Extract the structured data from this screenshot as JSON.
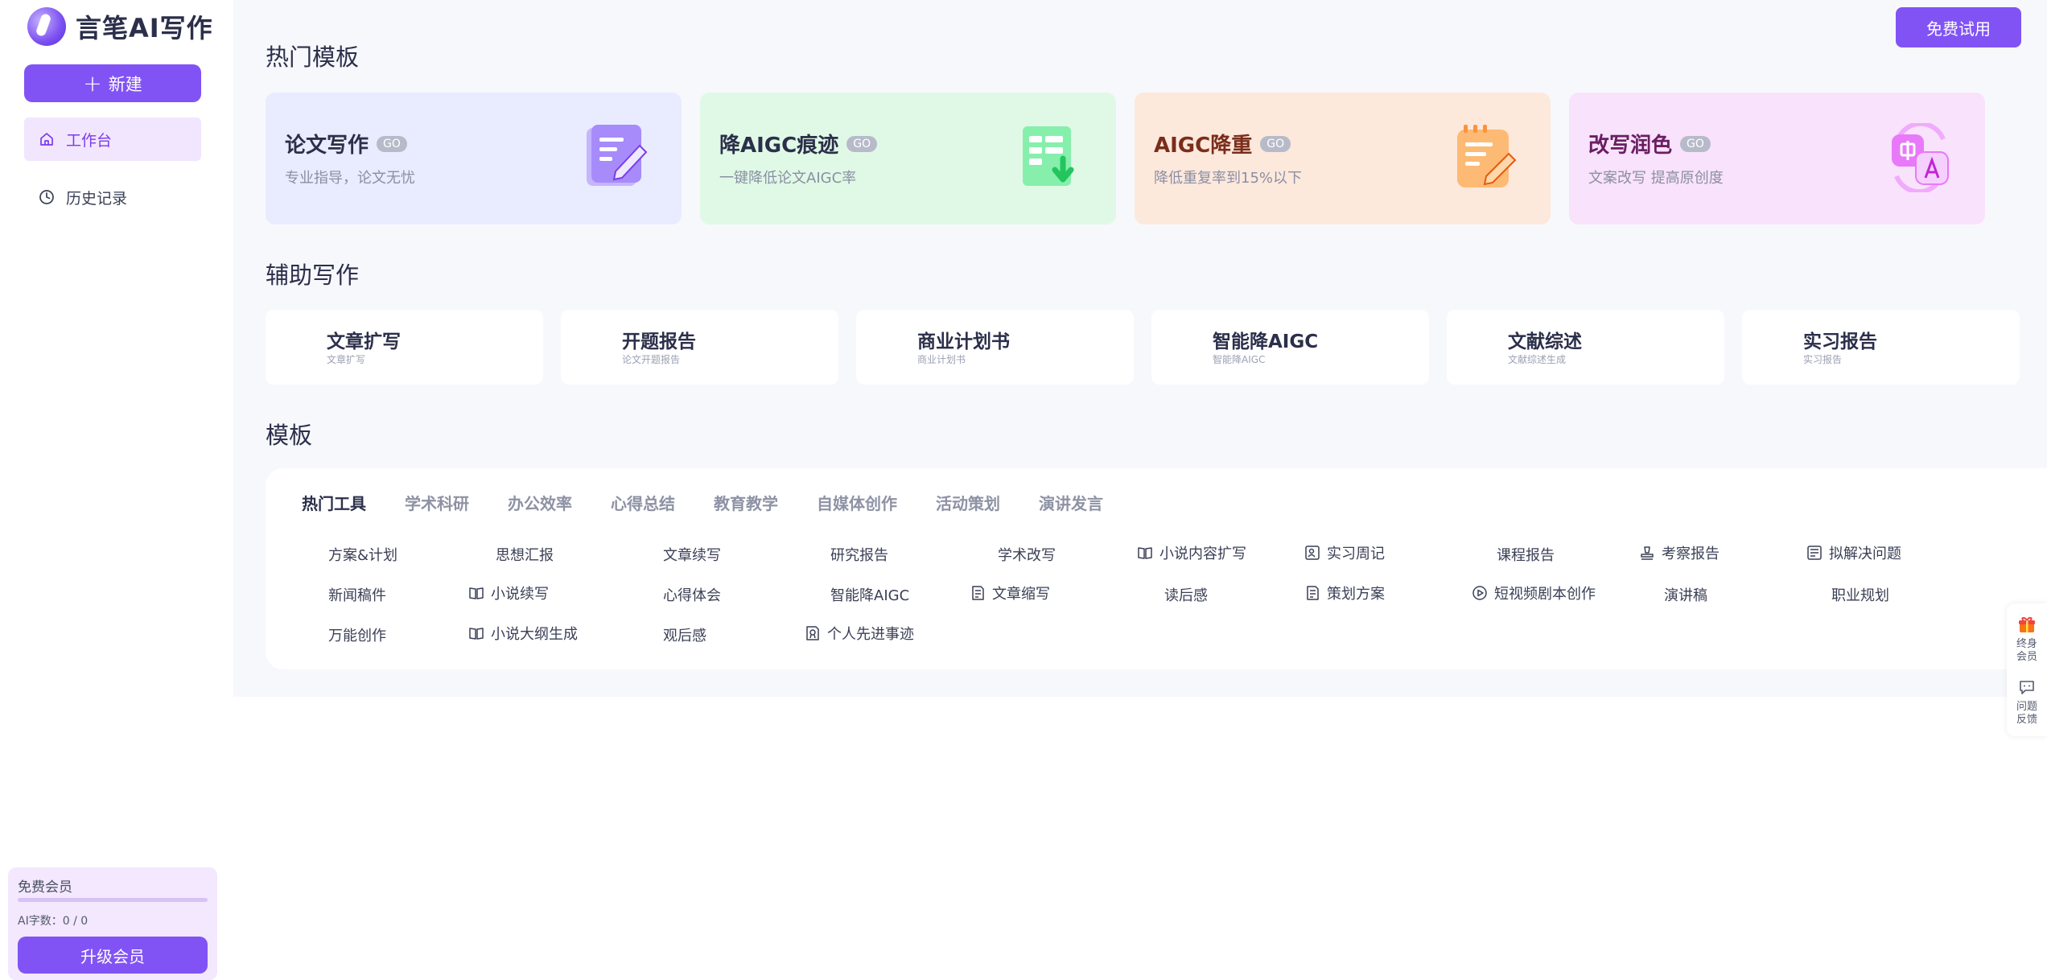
{
  "app": {
    "logo_text": "言笔AI写作"
  },
  "sidebar": {
    "new_label": "新建",
    "items": [
      {
        "label": "工作台",
        "icon": "home-icon",
        "active": true
      },
      {
        "label": "历史记录",
        "icon": "clock-icon",
        "active": false
      }
    ]
  },
  "member": {
    "title": "免费会员",
    "count": "AI字数：0 / 0",
    "upgrade_label": "升级会员"
  },
  "header": {
    "trial_label": "免费试用"
  },
  "hot": {
    "title": "热门模板",
    "cards": [
      {
        "title": "论文写作",
        "badge": "GO",
        "desc": "专业指导，论文无忧",
        "bg": "#e9ebfe",
        "color": "#2b2f4a",
        "icon": "pencil-doc-icon"
      },
      {
        "title": "降AIGC痕迹",
        "badge": "GO",
        "desc": "一键降低论文AIGC率",
        "bg": "#e0f9e6",
        "color": "#2b2f4a",
        "icon": "download-doc-icon"
      },
      {
        "title": "AIGC降重",
        "badge": "GO",
        "desc": "降低重复率到15%以下",
        "bg": "#fde8dc",
        "color": "#7a2d1b",
        "icon": "edit-note-icon"
      },
      {
        "title": "改写润色",
        "badge": "GO",
        "desc": "文案改写 提高原创度",
        "bg": "#f9e2fb",
        "color": "#6a1e63",
        "icon": "translate-icon"
      }
    ]
  },
  "aux": {
    "title": "辅助写作",
    "cards": [
      {
        "title": "文章扩写",
        "sub": "文章扩写"
      },
      {
        "title": "开题报告",
        "sub": "论文开题报告"
      },
      {
        "title": "商业计划书",
        "sub": "商业计划书"
      },
      {
        "title": "智能降AIGC",
        "sub": "智能降AIGC"
      },
      {
        "title": "文献综述",
        "sub": "文献综述生成"
      },
      {
        "title": "实习报告",
        "sub": "实习报告"
      }
    ]
  },
  "templates": {
    "title": "模板",
    "tabs": [
      "热门工具",
      "学术科研",
      "办公效率",
      "心得总结",
      "教育教学",
      "自媒体创作",
      "活动策划",
      "演讲发言"
    ],
    "items": [
      {
        "label": "方案&计划",
        "icon": ""
      },
      {
        "label": "思想汇报",
        "icon": ""
      },
      {
        "label": "文章续写",
        "icon": ""
      },
      {
        "label": "研究报告",
        "icon": ""
      },
      {
        "label": "学术改写",
        "icon": ""
      },
      {
        "label": "小说内容扩写",
        "icon": "book-icon"
      },
      {
        "label": "实习周记",
        "icon": "id-card-icon"
      },
      {
        "label": "课程报告",
        "icon": ""
      },
      {
        "label": "考察报告",
        "icon": "stamp-icon"
      },
      {
        "label": "拟解决问题",
        "icon": "list-doc-icon"
      },
      {
        "label": "新闻稿件",
        "icon": ""
      },
      {
        "label": "小说续写",
        "icon": "book-icon"
      },
      {
        "label": "心得体会",
        "icon": ""
      },
      {
        "label": "智能降AIGC",
        "icon": ""
      },
      {
        "label": "文章缩写",
        "icon": "doc-lines-icon"
      },
      {
        "label": "读后感",
        "icon": ""
      },
      {
        "label": "策划方案",
        "icon": "doc-lines-icon"
      },
      {
        "label": "短视频剧本创作",
        "icon": "play-circle-icon"
      },
      {
        "label": "演讲稿",
        "icon": ""
      },
      {
        "label": "职业规划",
        "icon": ""
      },
      {
        "label": "万能创作",
        "icon": ""
      },
      {
        "label": "小说大纲生成",
        "icon": "book-icon"
      },
      {
        "label": "观后感",
        "icon": ""
      },
      {
        "label": "个人先进事迹",
        "icon": "badge-doc-icon"
      }
    ]
  },
  "floating": {
    "items": [
      {
        "label": "终身会员",
        "icon": "gift-icon"
      },
      {
        "label": "问题反馈",
        "icon": "chat-icon"
      }
    ]
  },
  "colors": {
    "accent": "#8153f5",
    "active_nav_bg": "#f1e6fd",
    "active_nav_text": "#7c3aed"
  }
}
